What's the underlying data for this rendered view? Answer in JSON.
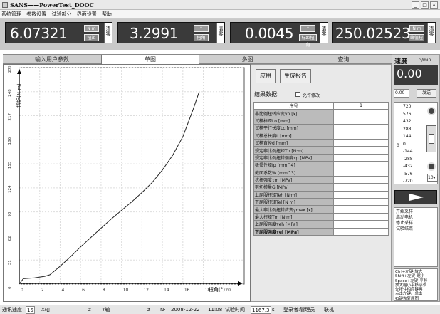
{
  "window": {
    "title": "SANS——PowerTest_DOOC"
  },
  "menu": [
    "系统管理",
    "参数设置",
    "试验部分",
    "界面设置",
    "帮助"
  ],
  "readouts": [
    {
      "value": "6.07321",
      "unit": "N·m",
      "label": "扭矩",
      "zero": "清零"
    },
    {
      "value": "3.2991",
      "unit": "°",
      "label": "扭角",
      "zero": "清零"
    },
    {
      "value": "0.0045",
      "unit": "°",
      "label": "标距扭角",
      "zero": "清零"
    },
    {
      "value": "250.02523",
      "unit": "N·m",
      "label": "峰值扭",
      "zero": "清零"
    }
  ],
  "tabs": [
    "输入用户参数",
    "单图",
    "多图",
    "查询"
  ],
  "active_tab": 1,
  "actions": {
    "apply": "应用",
    "report": "生成报告"
  },
  "results": {
    "title": "结果数据:",
    "allow_edit": "允许修改",
    "header_label": "序号",
    "header_index": "1",
    "rows": [
      "非比例扭转应变γp [x]",
      "试样标距Lo [mm]",
      "试样平行长度Lc [mm]",
      "试样总长度L [mm]",
      "试样直径d [mm]",
      "规定非比例扭矩Tp [N·m]",
      "规定非比例扭转强度τp [MPa]",
      "极惯性矩Ip [mm^4]",
      "截面系数W [mm^3]",
      "抗扭强度τm [MPa]",
      "剪切模量G [MPa]",
      "上屈服扭矩Teh [N·m]",
      "下屈服扭矩Tel [N·m]",
      "最大非比例扭转应变γmax [x]",
      "最大扭矩Tm [N·m]",
      "上屈服强度τeh [MPa]",
      "下屈服强度τel [MPa]"
    ]
  },
  "speed": {
    "title": "速度",
    "unit": "°/min",
    "value": "0.00",
    "input_value": "0.00",
    "send": "发送",
    "scale": [
      "720",
      "576",
      "432",
      "288",
      "144",
      "0",
      "-144",
      "-288",
      "-432",
      "-576",
      "-720"
    ],
    "zero_prefix": "0",
    "step_value": "10"
  },
  "log_lines": [
    "开始采样",
    "启动电机",
    "停止采样",
    "试验结束"
  ],
  "hints": [
    "Ctrl+左键-放大",
    "Shift+左键-缩小",
    "Space+左键-平移",
    "放大缩小平移必须",
    "先按住相应键再",
    "点击左键。单击",
    "右键恢复原图"
  ],
  "status": {
    "speed_label": "通讯速度",
    "speed_value": "15",
    "axis1": "X轴",
    "unit1": "z",
    "axis2": "Y轴",
    "unit2": "z",
    "angle": "N·",
    "date": "2008-12-22",
    "time": "11:08",
    "elapsed_label": "试验时间",
    "elapsed_value": "1167.3",
    "unit3": "s",
    "user_label": "登录者:管理员",
    "conn": "联机"
  },
  "chart_data": {
    "type": "line",
    "xlabel": "扭角(°)",
    "ylabel": "扭矩(N·m)",
    "xlim": [
      0,
      22
    ],
    "ylim": [
      0,
      279
    ],
    "xticks": [
      0,
      2,
      4,
      6,
      8,
      10,
      12,
      14,
      16,
      18,
      20
    ],
    "yticks": [
      0,
      31,
      62,
      93,
      124,
      155,
      186,
      217,
      248,
      279
    ],
    "x": [
      0,
      0.4,
      1.5,
      2.5,
      3,
      4,
      5,
      6,
      7,
      8,
      9,
      10,
      11,
      12,
      13,
      14,
      15,
      16,
      17,
      17.6
    ],
    "y": [
      0,
      7,
      8,
      10,
      12,
      23,
      35,
      48,
      60,
      72,
      84,
      95,
      106,
      118,
      131,
      147,
      166,
      190,
      225,
      248
    ]
  }
}
